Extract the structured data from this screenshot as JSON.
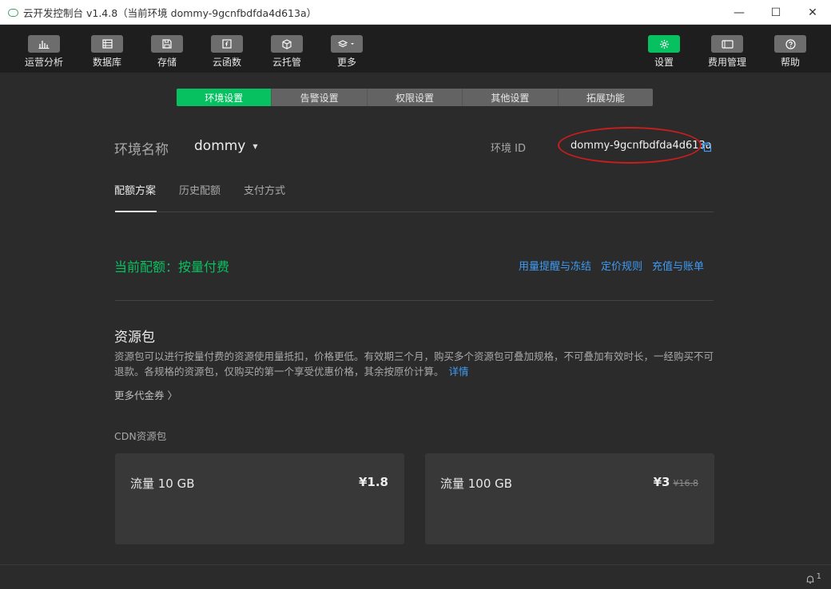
{
  "window": {
    "title": "云开发控制台 v1.4.8（当前环境 dommy-9gcnfbdfda4d613a）",
    "controls": [
      "—",
      "☐",
      "✕"
    ]
  },
  "toolbar": {
    "left_items": [
      {
        "label": "运营分析",
        "icon": "bar-chart-icon"
      },
      {
        "label": "数据库",
        "icon": "database-icon"
      },
      {
        "label": "存储",
        "icon": "save-icon"
      },
      {
        "label": "云函数",
        "icon": "function-icon"
      },
      {
        "label": "云托管",
        "icon": "cube-icon"
      },
      {
        "label": "更多",
        "icon": "layers-icon"
      }
    ],
    "right_items": [
      {
        "label": "设置",
        "icon": "gear-icon",
        "active": true
      },
      {
        "label": "费用管理",
        "icon": "billing-icon"
      },
      {
        "label": "帮助",
        "icon": "help-icon"
      }
    ]
  },
  "tabs": [
    "环境设置",
    "告警设置",
    "权限设置",
    "其他设置",
    "拓展功能"
  ],
  "env": {
    "label": "环境名称",
    "name": "dommy",
    "id_label": "环境 ID",
    "id_value": "dommy-9gcnfbdfda4d613a"
  },
  "subtabs": [
    "配额方案",
    "历史配额",
    "支付方式"
  ],
  "quota": {
    "current": "当前配额：按量付费",
    "links": [
      "用量提醒与冻结",
      "定价规则",
      "充值与账单"
    ]
  },
  "package": {
    "title": "资源包",
    "description": "资源包可以进行按量付费的资源使用量抵扣，价格更低。有效期三个月，购买多个资源包可叠加规格，不可叠加有效时长，一经购买不可退款。各规格的资源包，仅购买的第一个享受优惠价格，其余按原价计算。",
    "detail_link": "详情",
    "more_vouchers": "更多代金券 〉",
    "cdn_label": "CDN资源包",
    "cards": [
      {
        "name": "流量 10 GB",
        "price": "¥1.8",
        "old_price": ""
      },
      {
        "name": "流量 100 GB",
        "price": "¥3",
        "old_price": "¥16.8"
      }
    ]
  },
  "statusbar": {
    "notification_count": "1"
  },
  "colors": {
    "accent": "#07c160",
    "link": "#3f9bf4",
    "highlight": "#c81e1e"
  }
}
